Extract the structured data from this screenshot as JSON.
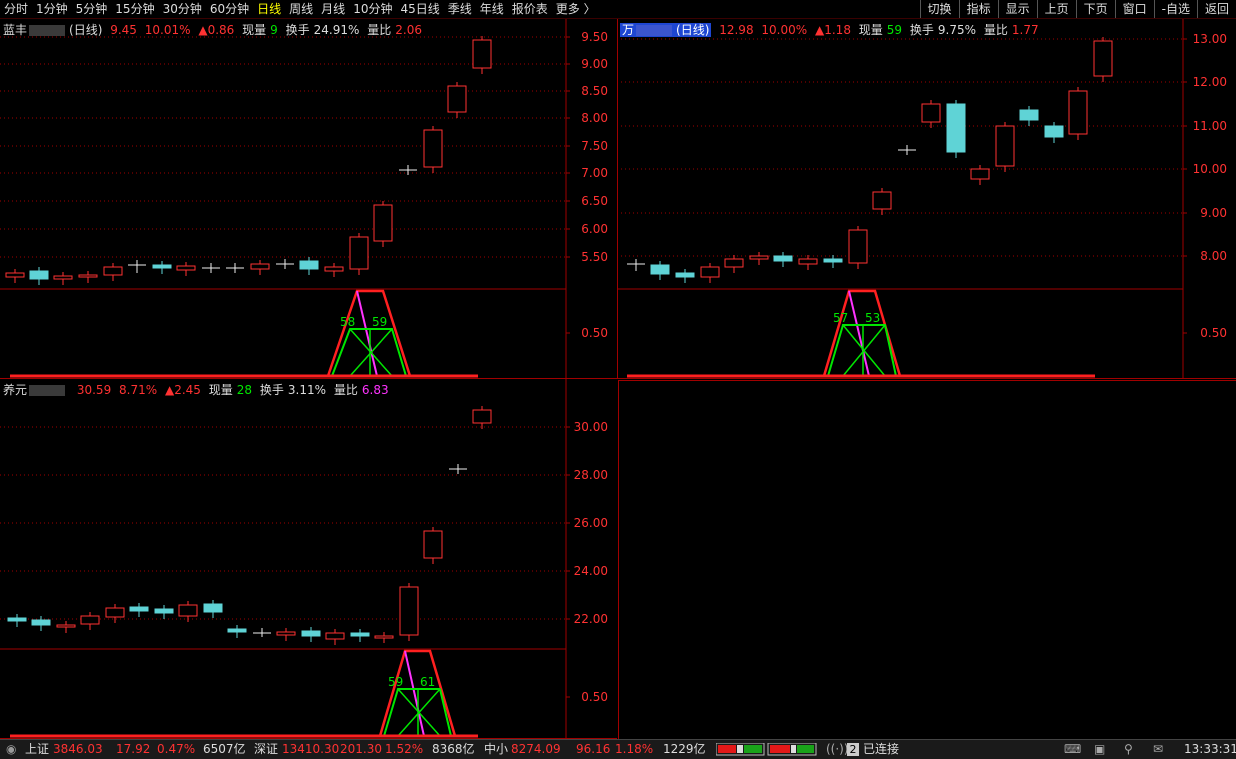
{
  "toolbar": {
    "tabs": [
      "分时",
      "1分钟",
      "5分钟",
      "15分钟",
      "30分钟",
      "60分钟",
      "日线",
      "周线",
      "月线",
      "10分钟",
      "45日线",
      "季线",
      "年线",
      "报价表",
      "更多 〉"
    ],
    "active_tab": "日线",
    "right_buttons": [
      "切换",
      "指标",
      "显示",
      "上页",
      "下页",
      "窗口",
      "-自选",
      "返回"
    ]
  },
  "panels": [
    {
      "name_prefix": "蓝丰",
      "period": "(日线)",
      "price": "9.45",
      "pct": "10.01%",
      "change": "▲0.86",
      "vol_label": "现量",
      "vol": "9",
      "turnover_label": "换手",
      "turnover": "24.91%",
      "ratio_label": "量比",
      "ratio": "2.06",
      "price_axis": [
        "9.50",
        "9.00",
        "8.50",
        "8.00",
        "7.50",
        "7.00",
        "6.50",
        "6.00",
        "5.50"
      ],
      "ind_axis": [
        "0.50"
      ],
      "ind_labels": [
        "58",
        "59"
      ]
    },
    {
      "name_prefix": "万",
      "period": "(日线)",
      "price": "12.98",
      "pct": "10.00%",
      "change": "▲1.18",
      "vol_label": "现量",
      "vol": "59",
      "turnover_label": "换手",
      "turnover": "9.75%",
      "ratio_label": "量比",
      "ratio": "1.77",
      "price_axis": [
        "13.00",
        "12.00",
        "11.00",
        "10.00",
        "9.00",
        "8.00"
      ],
      "ind_axis": [
        "0.50"
      ],
      "ind_labels": [
        "57",
        "53"
      ]
    },
    {
      "name_prefix": "养元",
      "period": "",
      "price": "30.59",
      "pct": "8.71%",
      "change": "▲2.45",
      "vol_label": "现量",
      "vol": "28",
      "turnover_label": "换手",
      "turnover": "3.11%",
      "ratio_label": "量比",
      "ratio": "6.83",
      "price_axis": [
        "30.00",
        "28.00",
        "26.00",
        "24.00",
        "22.00"
      ],
      "ind_axis": [
        "0.50"
      ],
      "ind_labels": [
        "59",
        "61"
      ]
    }
  ],
  "status": {
    "sh_label": "上证",
    "sh_value": "3846.03",
    "sh_chg": "17.92",
    "sh_pct": "0.47%",
    "sh_amt": "6507亿",
    "sz_label": "深证",
    "sz_value": "13410.30",
    "sz_chg": "201.30",
    "sz_pct": "1.52%",
    "sz_amt": "8368亿",
    "zx_label": "中小",
    "zx_value": "8274.09",
    "zx_chg": "96.16",
    "zx_pct": "1.18%",
    "zx_amt": "1229亿",
    "conn_count": "2",
    "conn_label": "已连接",
    "clock": "13:33:31"
  },
  "colors": {
    "up": "#ff3232",
    "down": "#5fd3d6",
    "grid": "#a00000",
    "ind_green": "#00e600",
    "ind_red": "#ff2020",
    "ind_mag": "#ff33ff"
  }
}
